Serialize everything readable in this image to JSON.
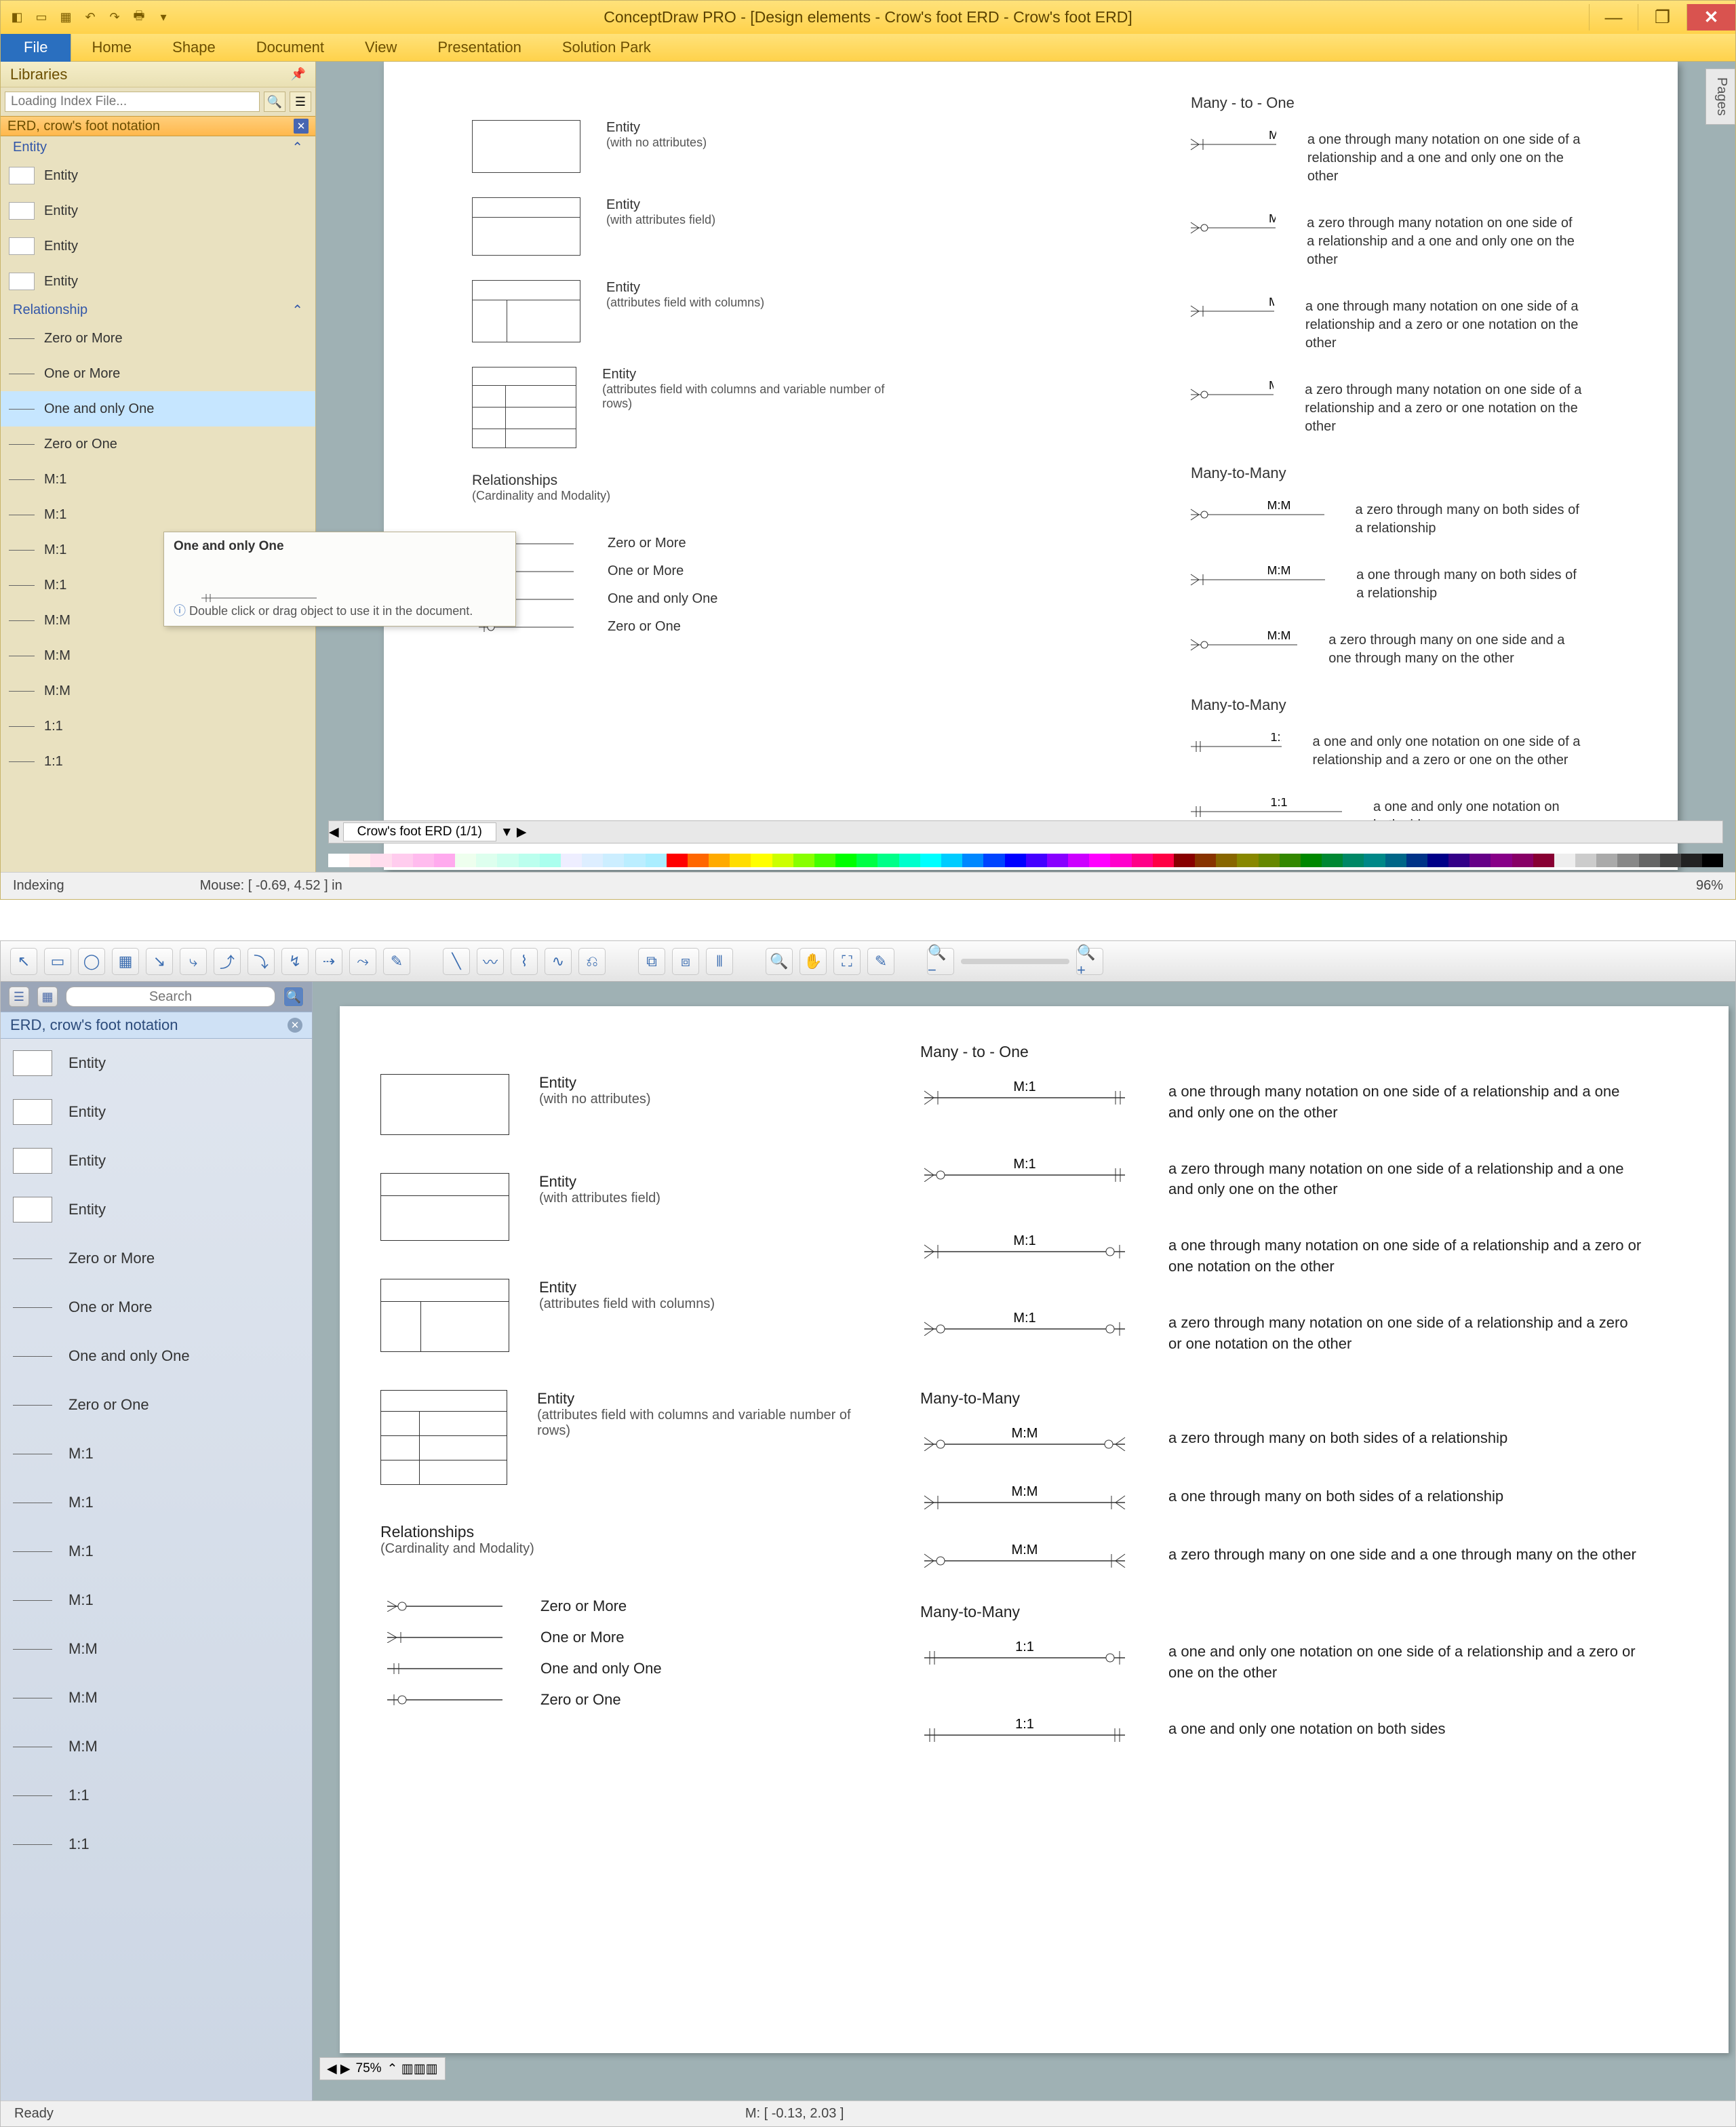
{
  "winA": {
    "title": "ConceptDraw PRO - [Design elements - Crow's foot ERD - Crow's foot ERD]",
    "ribbon": {
      "file": "File",
      "tabs": [
        "Home",
        "Shape",
        "Document",
        "View",
        "Presentation",
        "Solution Park"
      ]
    },
    "lib": {
      "header": "Libraries",
      "searchPlaceholder": "Loading Index File...",
      "title": "ERD, crow's foot notation",
      "catEntity": "Entity",
      "catRel": "Relationship",
      "entities": [
        "Entity",
        "Entity",
        "Entity",
        "Entity"
      ],
      "rels": [
        "Zero or More",
        "One or More",
        "One and only One",
        "Zero or One",
        "M:1",
        "M:1",
        "M:1",
        "M:1",
        "M:M",
        "M:M",
        "M:M",
        "1:1",
        "1:1"
      ]
    },
    "tooltip": {
      "title": "One and only One",
      "note": "Double click or drag object to use it in the document."
    },
    "page": {
      "tab": "Crow's foot ERD (1/1)",
      "pagesLabel": "Pages"
    },
    "status": {
      "indexing": "Indexing",
      "mouse": "Mouse: [ -0.69, 4.52 ] in",
      "zoom": "96%"
    }
  },
  "doc": {
    "sections": {
      "m1": "Many - to - One",
      "mm": "Many-to-Many",
      "mm2": "Many-to-Many",
      "rels": "Relationships",
      "relsSub": "(Cardinality and Modality)",
      "ent": "Entity"
    },
    "entities": [
      {
        "name": "Entity",
        "sub": "(with no attributes)",
        "shape": "plain"
      },
      {
        "name": "Entity",
        "sub": "(with attributes field)",
        "shape": "two"
      },
      {
        "name": "Entity",
        "sub": "(attributes field with columns)",
        "shape": "cols"
      },
      {
        "name": "Entity",
        "sub": "(attributes field with columns and variable number of rows)",
        "shape": "rows"
      }
    ],
    "legend": [
      {
        "label": "Zero or More"
      },
      {
        "label": "One or More"
      },
      {
        "label": "One and only One"
      },
      {
        "label": "Zero or One"
      }
    ],
    "m1": [
      {
        "r": "M:1",
        "t": "a one through many notation on one side of a relationship and a one and only one on the other"
      },
      {
        "r": "M:1",
        "t": "a zero through many notation on one side of a relationship and a one and only one on the other"
      },
      {
        "r": "M:1",
        "t": "a one through many notation on one side of a relationship and a zero or one notation on the other"
      },
      {
        "r": "M:1",
        "t": "a zero through many notation on one side of a relationship and a zero or one notation on the other"
      }
    ],
    "mm": [
      {
        "r": "M:M",
        "t": "a zero through many on both sides of a relationship"
      },
      {
        "r": "M:M",
        "t": "a one through many on both sides of a relationship"
      },
      {
        "r": "M:M",
        "t": "a zero through many on one side and a one through many on the other"
      }
    ],
    "oo": [
      {
        "r": "1:1",
        "t": "a one and only one notation on one side of a relationship and a zero or one on the other"
      },
      {
        "r": "1:1",
        "t": "a one and only one notation on both sides"
      }
    ]
  },
  "winB": {
    "search": "Search",
    "libTitle": "ERD, crow's foot notation",
    "stencils": [
      "Entity",
      "Entity",
      "Entity",
      "Entity",
      "Zero or More",
      "One or More",
      "One and only One",
      "Zero or One",
      "M:1",
      "M:1",
      "M:1",
      "M:1",
      "M:M",
      "M:M",
      "M:M",
      "1:1",
      "1:1"
    ],
    "zoom": "75%",
    "status": {
      "ready": "Ready",
      "mouse": "M: [ -0.13, 2.03 ]"
    }
  }
}
